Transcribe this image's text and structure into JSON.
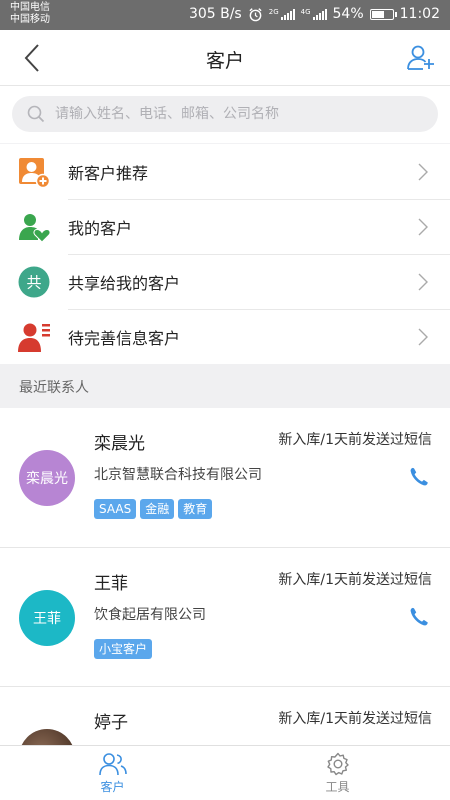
{
  "statusbar": {
    "carrier1": "中国电信",
    "carrier2": "中国移动",
    "speed": "305 B/s",
    "net1": "2G",
    "net2": "4G",
    "battery": "54%",
    "time": "11:02"
  },
  "header": {
    "title": "客户",
    "back_icon": "chevron-left-icon",
    "add_icon": "add-user-icon"
  },
  "search": {
    "placeholder": "请输入姓名、电话、邮箱、公司名称",
    "value": ""
  },
  "menu": [
    {
      "label": "新客户推荐",
      "icon": "new-customer-icon",
      "color": "#f08a35"
    },
    {
      "label": "我的客户",
      "icon": "my-customer-icon",
      "color": "#3aa64e"
    },
    {
      "label": "共享给我的客户",
      "icon": "shared-icon",
      "icon_text": "共",
      "color": "#3ea78a"
    },
    {
      "label": "待完善信息客户",
      "icon": "incomplete-info-icon",
      "color": "#d63b2f"
    }
  ],
  "section_title": "最近联系人",
  "contacts": [
    {
      "name": "栾晨光",
      "avatar_text": "栾晨光",
      "avatar_color": "#b785d3",
      "status": "新入库/1天前发送过短信",
      "company": "北京智慧联合科技有限公司",
      "tags": [
        "SAAS",
        "金融",
        "教育"
      ]
    },
    {
      "name": "王菲",
      "avatar_text": "王菲",
      "avatar_color": "#1cb8c6",
      "status": "新入库/1天前发送过短信",
      "company": "饮食起居有限公司",
      "tags": [
        "小宝客户"
      ]
    },
    {
      "name": "婷子",
      "avatar_text": "",
      "avatar_color": "#5a3a2a",
      "status": "新入库/1天前发送过短信",
      "company": "",
      "tags": []
    }
  ],
  "tabs": [
    {
      "label": "客户",
      "icon": "customers-tab-icon",
      "active": true
    },
    {
      "label": "工具",
      "icon": "gear-icon",
      "active": false
    }
  ],
  "colors": {
    "accent": "#3b8fe0",
    "tag": "#5ba7ec"
  }
}
